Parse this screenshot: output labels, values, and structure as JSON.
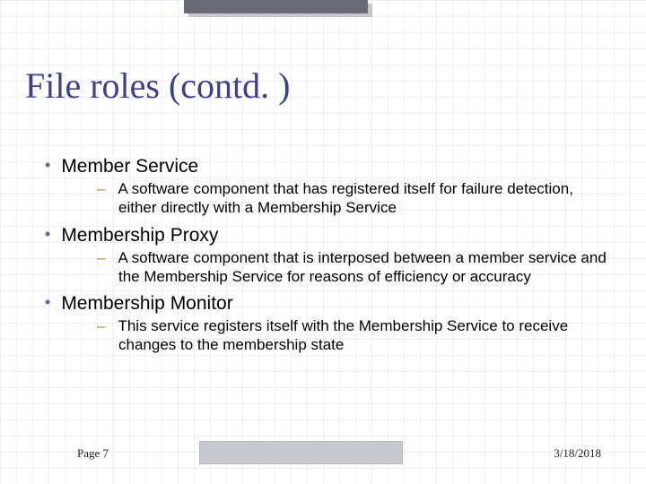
{
  "title": "File roles (contd. )",
  "bullets": [
    {
      "heading": "Member Service",
      "sub": "A software component that has registered itself for failure detection, either directly with a Membership Service"
    },
    {
      "heading": "Membership Proxy",
      "sub": "A software component that is interposed between a member service and the Membership Service for reasons of efficiency or accuracy"
    },
    {
      "heading": "Membership Monitor",
      "sub": "This service registers itself with the Membership Service to receive changes to the membership state"
    }
  ],
  "footer": {
    "page": "Page 7",
    "date": "3/18/2018"
  }
}
